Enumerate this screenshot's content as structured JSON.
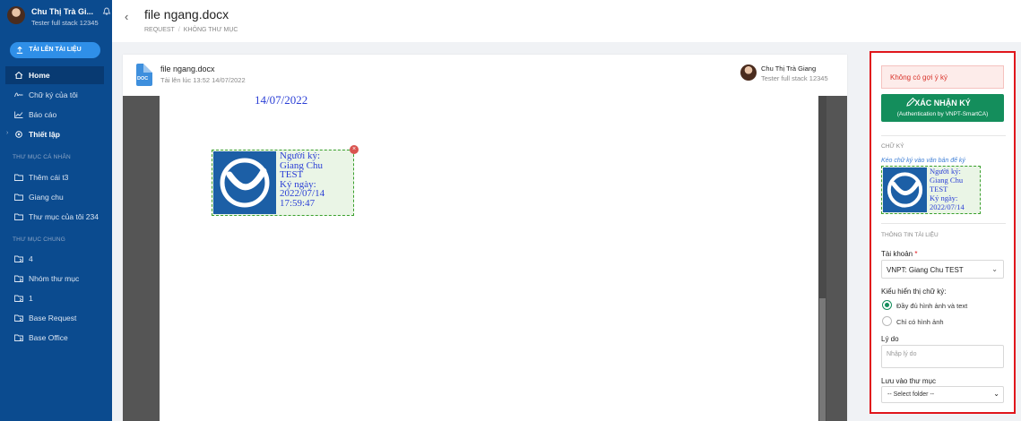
{
  "sidebar": {
    "user": {
      "name": "Chu Thị Trà Gi...",
      "subtitle": "Tester full stack 12345"
    },
    "upload_label": "TẢI LÊN TÀI LIỆU",
    "nav": [
      {
        "label": "Home",
        "icon": "home-icon",
        "active": true
      },
      {
        "label": "Chữ ký của tôi",
        "icon": "signature-icon"
      },
      {
        "label": "Báo cáo",
        "icon": "report-icon"
      },
      {
        "label": "Thiết lập",
        "icon": "gear-icon"
      }
    ],
    "personal_section": "THƯ MỤC CÁ NHÂN",
    "personal_folders": [
      "Thêm cái t3",
      "Giang chu",
      "Thư mục của tôi 234"
    ],
    "shared_section": "THƯ MỤC CHUNG",
    "shared_folders": [
      "4",
      "Nhóm thư mục",
      "1",
      "Base Request",
      "Base Office"
    ]
  },
  "header": {
    "title": "file ngang.docx",
    "breadcrumb": [
      "REQUEST",
      "KHÔNG THƯ MỤC"
    ]
  },
  "document": {
    "icon_label": "DOC",
    "file_name": "file ngang.docx",
    "uploaded": "Tải lên lúc 13:52 14/07/2022",
    "owner_name": "Chu Thị Trà Giang",
    "owner_subtitle": "Tester full stack 12345",
    "page_date": "14/07/2022",
    "signature_lines": [
      "Người ký:",
      "Giang Chu",
      "TEST",
      "Ký ngày:",
      "2022/07/14",
      "17:59:47"
    ]
  },
  "panel": {
    "alert": "Không có gợi ý ký",
    "confirm_title": "XÁC NHẬN KÝ",
    "confirm_sub": "(Authentication by VNPT-SmartCA)",
    "sig_section": "CHỮ KÝ",
    "sig_hint": "Kéo chữ ký vào văn bản để ký",
    "sig_preview_lines": [
      "Người ký:",
      "Giang Chu",
      "TEST",
      "Ký ngày:",
      "2022/07/14"
    ],
    "info_section": "THÔNG TIN TÀI LIỆU",
    "account_label": "Tài khoản",
    "account_value": "VNPT: Giang Chu TEST",
    "display_label": "Kiểu hiển thị chữ ký:",
    "display_options": [
      "Đầy đủ hình ảnh và text",
      "Chỉ có hình ảnh"
    ],
    "reason_label": "Lý do",
    "reason_placeholder": "Nhập lý do",
    "folder_label": "Lưu vào thư mục",
    "folder_value": "-- Select folder --"
  },
  "colors": {
    "sidebar": "#0b4b8f",
    "accent": "#148e5c",
    "alert": "#d9342b",
    "highlight_border": "#e0161c"
  }
}
